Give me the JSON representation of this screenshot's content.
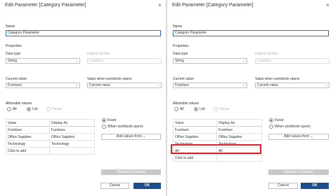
{
  "dialog": {
    "title": "Edit Parameter [Category Parameter]",
    "close_glyph": "×",
    "name_label": "Name",
    "name_value": "Category Parameter",
    "properties_label": "Properties",
    "data_type_label": "Data type",
    "data_type_value": "String",
    "display_format_label": "Display format",
    "display_format_value": "Furniture",
    "current_value_label": "Current value",
    "current_value_value": "Furniture",
    "workbook_opens_label": "Value when workbook opens",
    "workbook_opens_value": "Current value",
    "allowable_values_label": "Allowable values",
    "allowable_options": [
      "All",
      "List",
      "Range"
    ],
    "selected_allowable": "List",
    "table_headers": [
      "Value",
      "Display As"
    ],
    "fixed_label": "Fixed",
    "when_opens_label": "When workbook opens",
    "add_values_label": "Add values from",
    "remove_selected_label": "Remove Selected",
    "cancel_label": "Cancel",
    "ok_label": "OK",
    "chevron_glyph": "⌄"
  },
  "left_table": {
    "rows": [
      [
        "Furniture",
        "Furniture"
      ],
      [
        "Office Supplies",
        "Office Supplies"
      ],
      [
        "Technology",
        "Technology"
      ],
      [
        "Click to add",
        ""
      ]
    ]
  },
  "right_table": {
    "rows": [
      [
        "Furniture",
        "Furniture"
      ],
      [
        "Office Supplies",
        "Office Supplies"
      ],
      [
        "Technology",
        "Technology"
      ],
      [
        "All",
        "All"
      ],
      [
        "Click to add",
        ""
      ]
    ]
  },
  "colors": {
    "ok_button": "#1f4e8c",
    "highlight": "#e0202a",
    "name_border": "#2b6ec7"
  }
}
